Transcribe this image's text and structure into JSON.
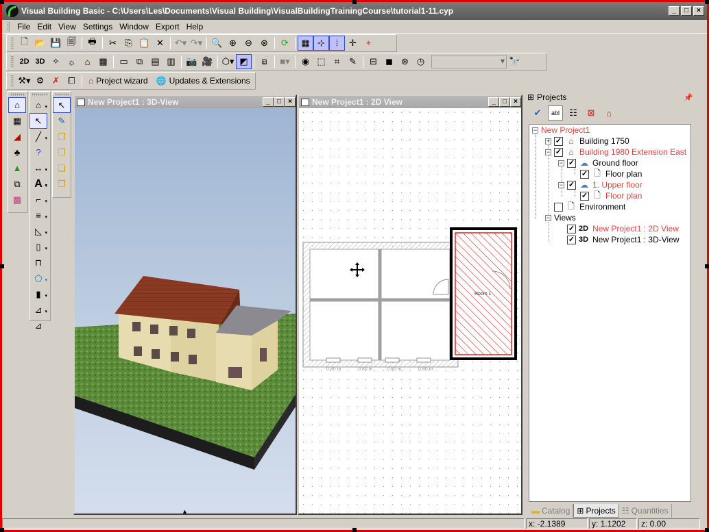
{
  "window": {
    "title": "Visual Building Basic - C:\\Users\\Les\\Documents\\Visual Building\\VisualBuildingTrainingCourse\\tutorial1-11.cyp"
  },
  "menu": [
    "File",
    "Edit",
    "View",
    "Settings",
    "Window",
    "Export",
    "Help"
  ],
  "toolbar3": {
    "project_wizard": "Project wizard",
    "updates": "Updates & Extensions"
  },
  "view3d": {
    "title": "New Project1 : 3D-View"
  },
  "view2d": {
    "title": "New Project1 : 2D View",
    "room_label": "Room 1",
    "dims": [
      "0.80 m",
      "0.80 m",
      "0.80 m",
      "0.80 m"
    ]
  },
  "projects": {
    "header": "Projects",
    "tree": {
      "root": "New Project1",
      "building1": "Building 1750",
      "building2": "Building 1980 Extension East",
      "ground_floor": "Ground floor",
      "floor_plan1": "Floor plan",
      "upper_floor": "1. Upper floor",
      "floor_plan2": "Floor plan",
      "environment": "Environment",
      "views": "Views",
      "view2d_tag": "2D",
      "view2d": "New Project1 : 2D View",
      "view3d_tag": "3D",
      "view3d": "New Project1 : 3D-View"
    },
    "tabs": [
      "Catalog",
      "Projects",
      "Quantities"
    ]
  },
  "status": {
    "x": "x: -2.1389",
    "y": "y: 1.1202",
    "z": "z: 0.00"
  },
  "colors": {
    "frame": "#e00000",
    "selected_room": "#e02020",
    "highlight_text": "#e04040"
  }
}
